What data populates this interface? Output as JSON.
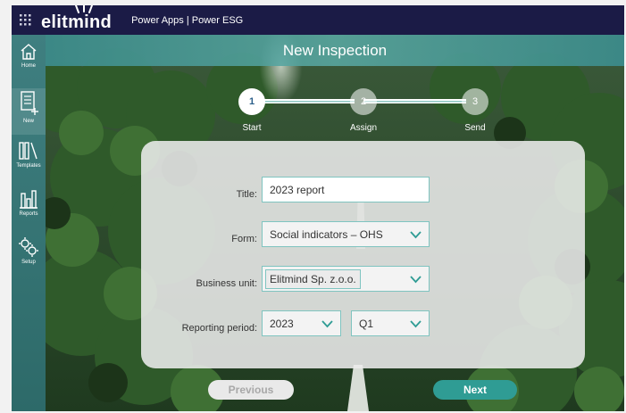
{
  "appbar": {
    "waffle_icon": "waffle-icon",
    "logo_text": "elitmind",
    "app_title": "Power Apps | Power ESG",
    "bg_color": "#1b1b46"
  },
  "sidebar": {
    "items": [
      {
        "label": "Home",
        "icon": "home-icon"
      },
      {
        "label": "New",
        "icon": "new-document-icon"
      },
      {
        "label": "Templates",
        "icon": "templates-icon"
      },
      {
        "label": "Reports",
        "icon": "reports-icon"
      },
      {
        "label": "Setup",
        "icon": "gear-icon"
      }
    ]
  },
  "header": {
    "title": "New Inspection"
  },
  "stepper": {
    "steps": [
      {
        "number": "1",
        "label": "Start"
      },
      {
        "number": "2",
        "label": "Assign"
      },
      {
        "number": "3",
        "label": "Send"
      }
    ]
  },
  "form": {
    "title_label": "Title:",
    "title_value": "2023 report",
    "form_label": "Form:",
    "form_value": "Social indicators – OHS",
    "business_unit_label": "Business unit:",
    "business_unit_value": "Elitmind Sp. z.o.o.",
    "reporting_period_label": "Reporting period:",
    "year_value": "2023",
    "quarter_value": "Q1"
  },
  "buttons": {
    "previous": "Previous",
    "next": "Next"
  },
  "colors": {
    "accent": "#2f9c94",
    "field_border": "#7fc4c0",
    "sidebar": "#3f7f80"
  }
}
